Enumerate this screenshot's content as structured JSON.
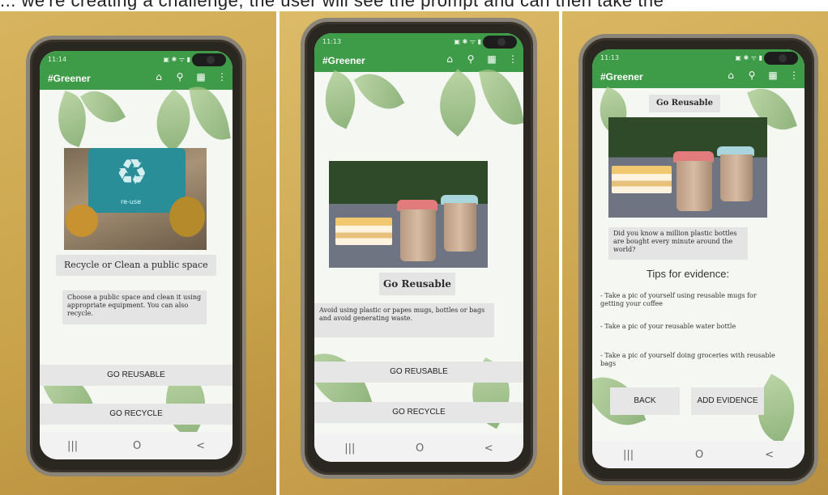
{
  "caption": "... we're creating a challenge, the user will see the prompt and can then take the",
  "app": {
    "title": "#Greener",
    "icons": [
      "home-icon",
      "search-icon",
      "dashboard-icon",
      "more-vert-icon"
    ]
  },
  "screens": [
    {
      "status_time": "11:14",
      "heading": "Recycle or Clean a public space",
      "description": "Choose a public space and clean it using appropriate equipment. You can also recycle.",
      "photo_text": "re-use",
      "buttons": [
        "GO REUSABLE",
        "GO RECYCLE"
      ]
    },
    {
      "status_time": "11:13",
      "heading": "Go Reusable",
      "description": "Avoid using plastic or papes mugs, bottles or bags and avoid generating waste.",
      "buttons": [
        "GO REUSABLE",
        "GO RECYCLE"
      ]
    },
    {
      "status_time": "11:13",
      "heading": "Go Reusable",
      "fact": "Did you know a million plastic bottles are bought every minute around the world?",
      "tips_title": "Tips for evidence:",
      "tips": [
        "- Take a pic of yourself using reusable mugs for getting your coffee",
        "- Take a pic of your reusable water bottle",
        "- Take a pic of yourself doing groceries with reusable bags"
      ],
      "buttons": [
        "BACK",
        "ADD EVIDENCE"
      ]
    }
  ],
  "navbar": [
    "|||",
    "O",
    "<"
  ],
  "colors": {
    "appbar": "#3e9b48",
    "button": "#e6e6e6",
    "label_bg": "#e4e4e4"
  }
}
